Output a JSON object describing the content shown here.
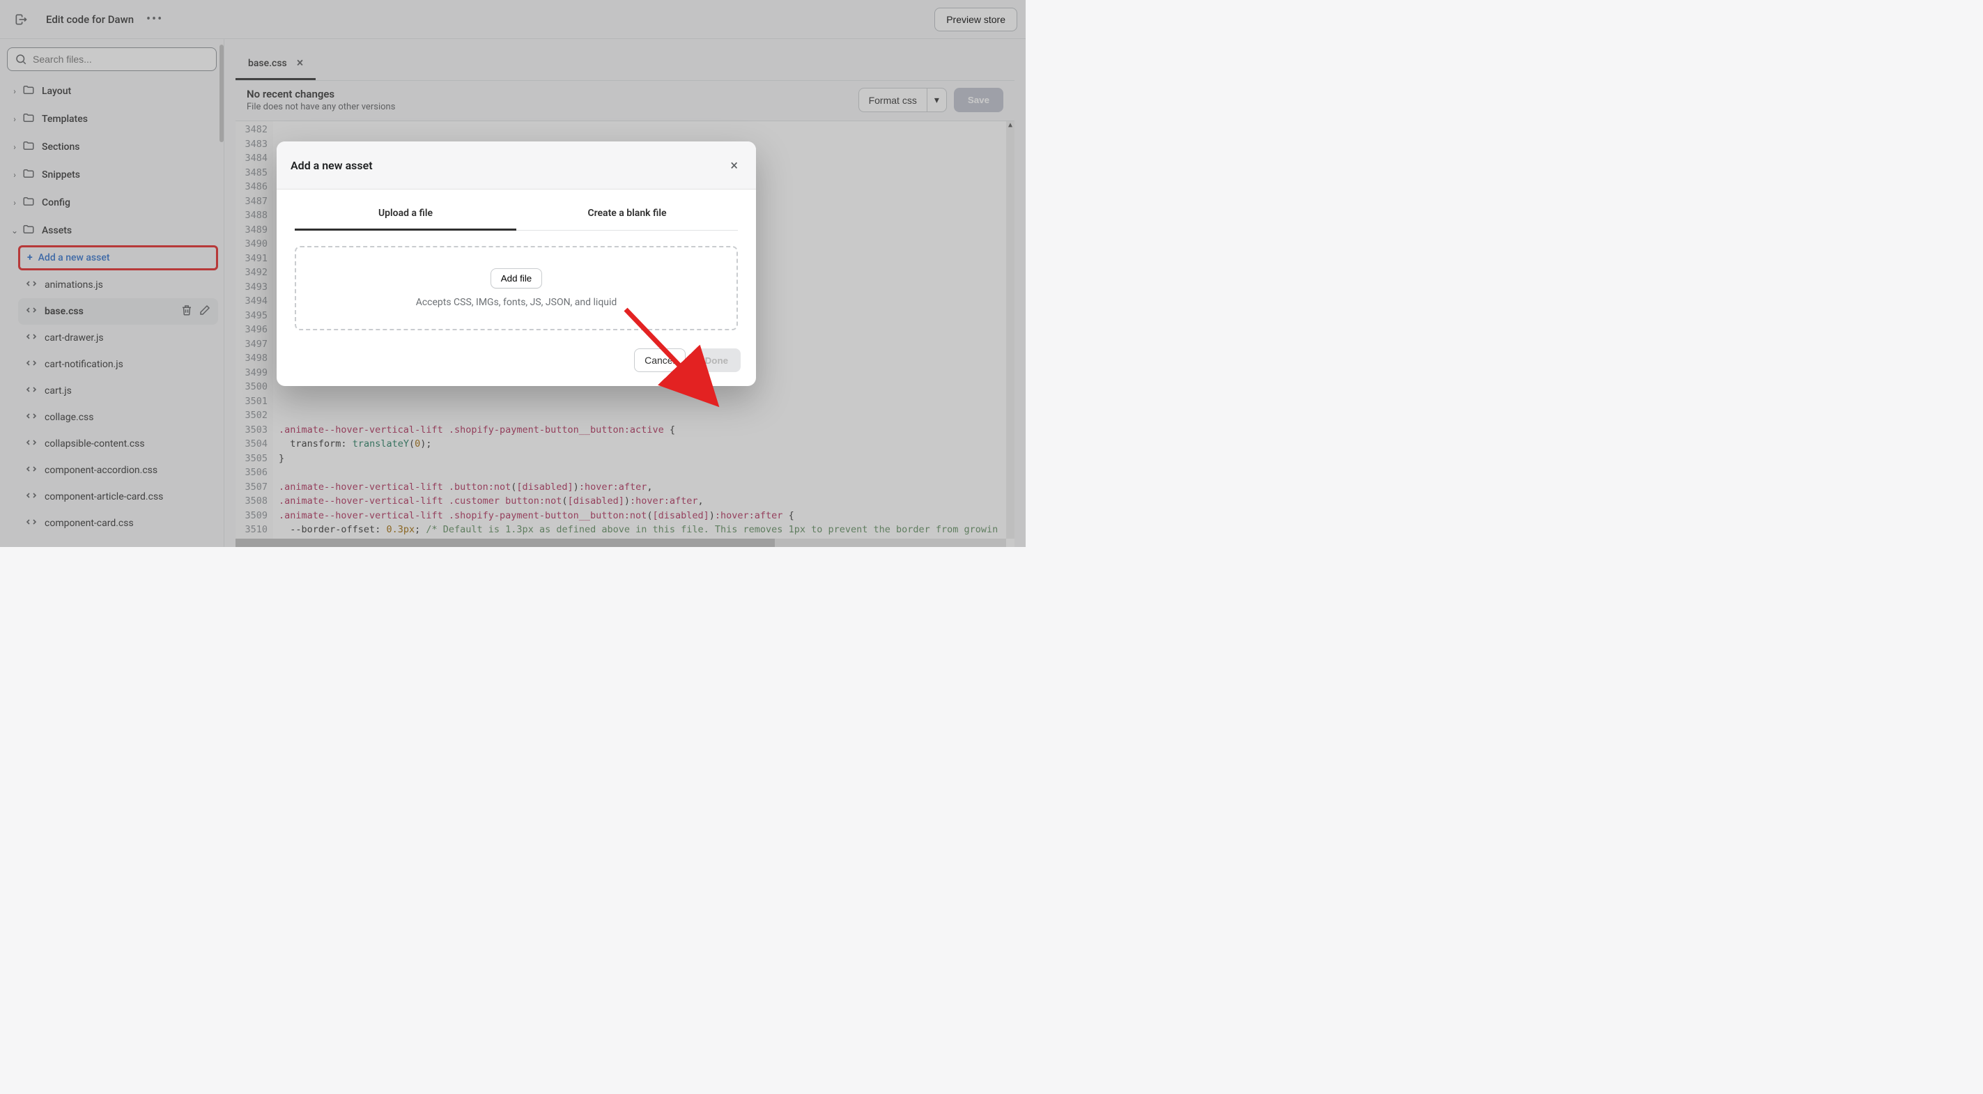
{
  "header": {
    "title": "Edit code for Dawn",
    "preview_btn": "Preview store"
  },
  "sidebar": {
    "search_placeholder": "Search files...",
    "folders": [
      {
        "label": "Layout",
        "expanded": false
      },
      {
        "label": "Templates",
        "expanded": false
      },
      {
        "label": "Sections",
        "expanded": false
      },
      {
        "label": "Snippets",
        "expanded": false
      },
      {
        "label": "Config",
        "expanded": false
      },
      {
        "label": "Assets",
        "expanded": true
      }
    ],
    "add_asset_label": "Add a new asset",
    "files": [
      {
        "name": "animations.js",
        "selected": false
      },
      {
        "name": "base.css",
        "selected": true
      },
      {
        "name": "cart-drawer.js",
        "selected": false
      },
      {
        "name": "cart-notification.js",
        "selected": false
      },
      {
        "name": "cart.js",
        "selected": false
      },
      {
        "name": "collage.css",
        "selected": false
      },
      {
        "name": "collapsible-content.css",
        "selected": false
      },
      {
        "name": "component-accordion.css",
        "selected": false
      },
      {
        "name": "component-article-card.css",
        "selected": false
      },
      {
        "name": "component-card.css",
        "selected": false
      }
    ]
  },
  "editor": {
    "tab_label": "base.css",
    "recent_title": "No recent changes",
    "recent_sub": "File does not have any other versions",
    "format_btn": "Format css",
    "save_btn": "Save",
    "gutter_start": 3482,
    "gutter_end": 3510,
    "code_html": "<span class='c-sel'>.animate--hover-vertical-lift</span> <span class='c-sel'>.shopify-payment-button__button:active</span> <span class='c-punc'>{</span>\n  <span class='c-prop'>transform</span><span class='c-punc'>:</span> <span class='c-func'>translateY</span><span class='c-punc'>(</span><span class='c-num'>0</span><span class='c-punc'>);</span>\n<span class='c-punc'>}</span>\n\n<span class='c-sel'>.animate--hover-vertical-lift</span> <span class='c-sel'>.button:not</span><span class='c-punc'>(</span><span class='c-sel'>[disabled]</span><span class='c-punc'>)</span><span class='c-sel'>:hover:after</span><span class='c-punc'>,</span>\n<span class='c-sel'>.animate--hover-vertical-lift</span> <span class='c-sel'>.customer</span> <span class='c-sel'>button:not</span><span class='c-punc'>(</span><span class='c-sel'>[disabled]</span><span class='c-punc'>)</span><span class='c-sel'>:hover:after</span><span class='c-punc'>,</span>\n<span class='c-sel'>.animate--hover-vertical-lift</span> <span class='c-sel'>.shopify-payment-button__button:not</span><span class='c-punc'>(</span><span class='c-sel'>[disabled]</span><span class='c-punc'>)</span><span class='c-sel'>:hover:after</span> <span class='c-punc'>{</span>\n  <span class='c-prop'>--border-offset</span><span class='c-punc'>:</span> <span class='c-num'>0.3px</span><span class='c-punc'>;</span> <span class='c-comment'>/* Default is 1.3px as defined above in this file. This removes 1px to prevent the border from growin</span>"
  },
  "modal": {
    "title": "Add a new asset",
    "tab_upload": "Upload a file",
    "tab_blank": "Create a blank file",
    "addfile_btn": "Add file",
    "accepts": "Accepts CSS, IMGs, fonts, JS, JSON, and liquid",
    "cancel": "Cancel",
    "done": "Done"
  }
}
